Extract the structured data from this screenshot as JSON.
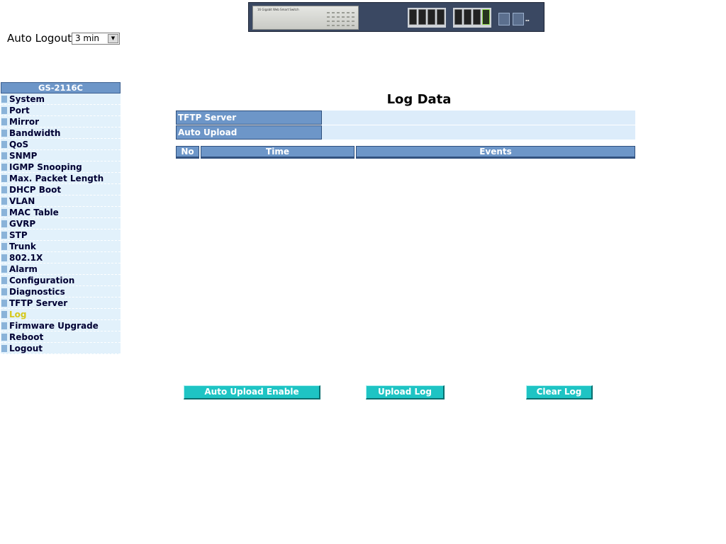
{
  "banner": {
    "caption": "16 Gigabit Web Smart Switch"
  },
  "auto_logout": {
    "label": "Auto Logout",
    "selected": "3 min"
  },
  "menu": {
    "header": "GS-2116C",
    "active": "Log",
    "items": [
      {
        "label": "System"
      },
      {
        "label": "Port"
      },
      {
        "label": "Mirror"
      },
      {
        "label": "Bandwidth"
      },
      {
        "label": "QoS"
      },
      {
        "label": "SNMP"
      },
      {
        "label": "IGMP Snooping"
      },
      {
        "label": "Max. Packet Length"
      },
      {
        "label": "DHCP Boot"
      },
      {
        "label": "VLAN"
      },
      {
        "label": "MAC Table"
      },
      {
        "label": "GVRP"
      },
      {
        "label": "STP"
      },
      {
        "label": "Trunk"
      },
      {
        "label": "802.1X"
      },
      {
        "label": "Alarm"
      },
      {
        "label": "Configuration"
      },
      {
        "label": "Diagnostics"
      },
      {
        "label": "TFTP Server"
      },
      {
        "label": "Log"
      },
      {
        "label": "Firmware Upgrade"
      },
      {
        "label": "Reboot"
      },
      {
        "label": "Logout"
      }
    ]
  },
  "main": {
    "title": "Log Data",
    "tftp_server": {
      "label": "TFTP Server",
      "value": ""
    },
    "auto_upload": {
      "label": "Auto Upload",
      "value": ""
    },
    "table": {
      "columns": [
        "No",
        "Time",
        "Events"
      ],
      "rows": []
    },
    "buttons": {
      "auto_upload_enable": "Auto Upload Enable",
      "upload_log": "Upload Log",
      "clear_log": "Clear Log"
    }
  },
  "colors": {
    "menu_header": "#6d96c8",
    "menu_item_bg": "#e2f1fb",
    "active_item_text": "#d6c81a",
    "button_bg": "#1ec4c4",
    "value_cell_bg": "#dcecfa"
  }
}
